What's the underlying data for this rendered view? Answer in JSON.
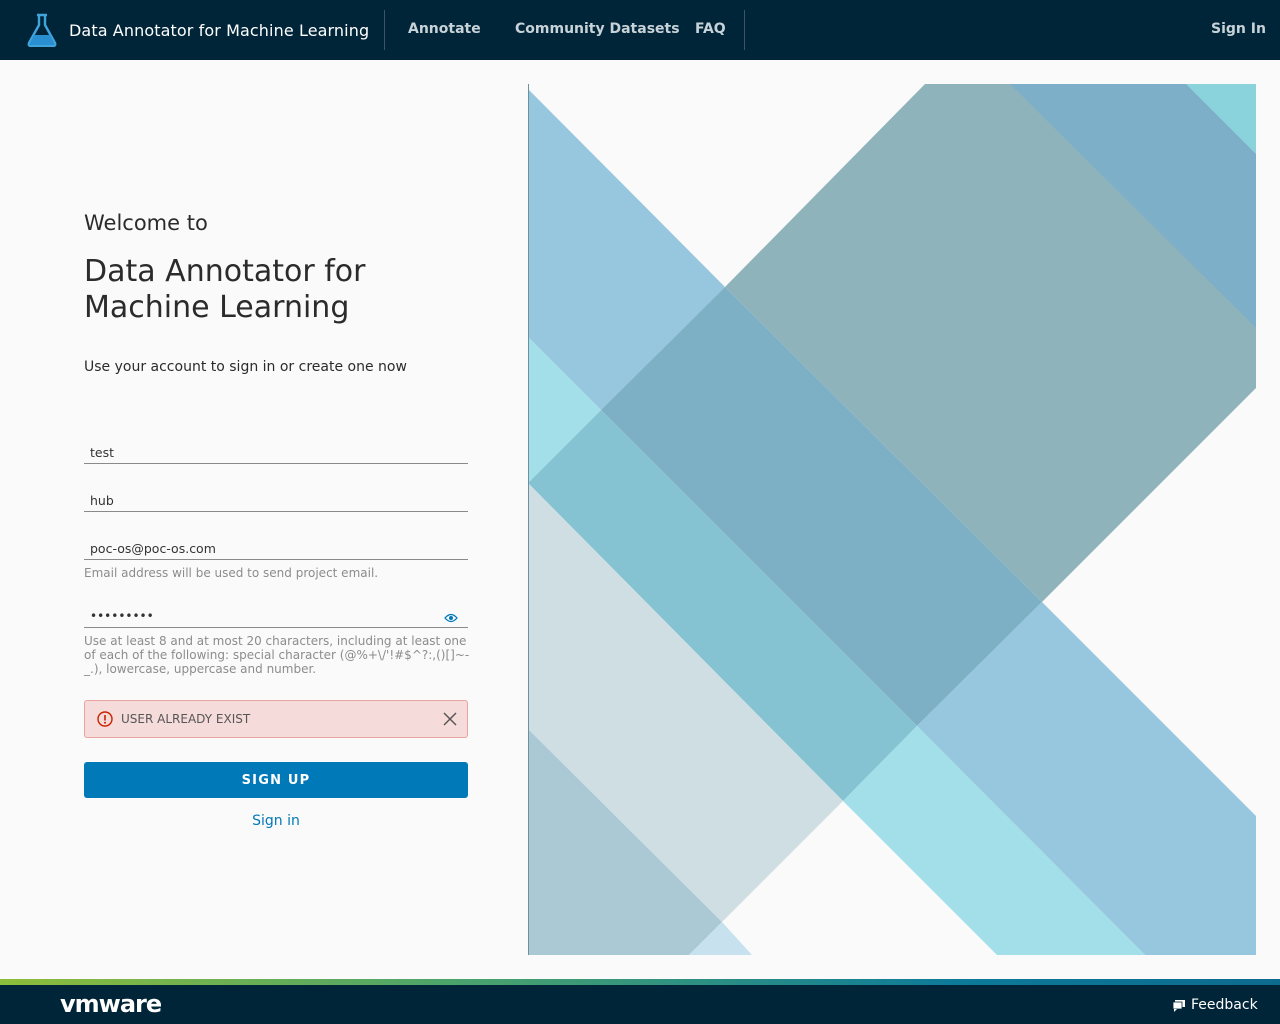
{
  "header": {
    "app_title": "Data Annotator for Machine Learning",
    "nav": [
      "Annotate",
      "Community Datasets",
      "FAQ"
    ],
    "sign_in": "Sign In"
  },
  "form": {
    "welcome": "Welcome to",
    "app_name": "Data Annotator for Machine Learning",
    "subtitle": "Use your account to sign in or create one now",
    "first_name": "test",
    "last_name": "hub",
    "email": "poc-os@poc-os.com",
    "email_help": "Email address will be used to send project email.",
    "password": "•••••••••",
    "password_help": "Use at least 8 and at most 20 characters, including at least one of each of the following: special character (@%+\\/'!#$^?:,()[]~-_.), lowercase, uppercase and number.",
    "error": "USER ALREADY EXIST",
    "signup_button": "SIGN UP",
    "signin_link": "Sign in"
  },
  "footer": {
    "logo": "vmware",
    "feedback": "Feedback"
  },
  "colors": {
    "header_bg": "#002538",
    "primary": "#0079b8",
    "error_bg": "#f5dbd9"
  }
}
